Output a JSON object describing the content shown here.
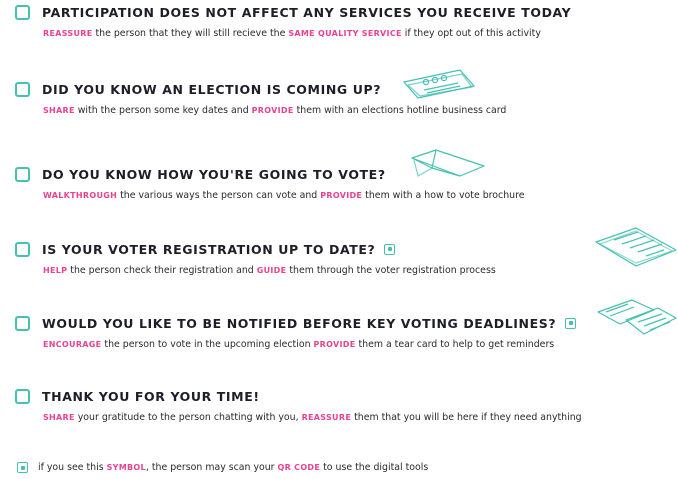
{
  "colors": {
    "accent": "#45c1b2",
    "highlight": "#e8438f",
    "text": "#1e1e28"
  },
  "items": [
    {
      "title": "PARTICIPATION DOES NOT AFFECT ANY SERVICES YOU RECEIVE TODAY",
      "desc": [
        {
          "hl": "REASSURE"
        },
        {
          "t": " the person that they will still recieve the "
        },
        {
          "hl": "SAME QUALITY SERVICE"
        },
        {
          "t": " if they opt out of this activity"
        }
      ]
    },
    {
      "title": "DID YOU KNOW AN ELECTION IS COMING UP?",
      "desc": [
        {
          "hl": "SHARE"
        },
        {
          "t": " with the person some key dates and "
        },
        {
          "hl": "PROVIDE"
        },
        {
          "t": " them with an elections hotline business card"
        }
      ]
    },
    {
      "title": "DO YOU KNOW HOW YOU'RE GOING TO VOTE?",
      "desc": [
        {
          "hl": "WALKTHROUGH"
        },
        {
          "t": " the various ways the person can vote and "
        },
        {
          "hl": "PROVIDE"
        },
        {
          "t": " them with a how to vote brochure"
        }
      ]
    },
    {
      "title": "IS YOUR VOTER REGISTRATION UP TO DATE?",
      "desc": [
        {
          "hl": "HELP"
        },
        {
          "t": " the person check their registration and "
        },
        {
          "hl": "GUIDE"
        },
        {
          "t": " them through the voter registration process"
        }
      ]
    },
    {
      "title": "WOULD YOU LIKE TO BE NOTIFIED BEFORE KEY VOTING DEADLINES?",
      "desc": [
        {
          "hl": "ENCOURAGE"
        },
        {
          "t": " the person to vote in the upcoming election "
        },
        {
          "hl": "PROVIDE"
        },
        {
          "t": " them a tear card to help to get reminders"
        }
      ]
    },
    {
      "title": "THANK YOU FOR YOUR TIME!",
      "desc": [
        {
          "hl": "SHARE"
        },
        {
          "t": " your gratitude to the person chatting with you, "
        },
        {
          "hl": "REASSURE"
        },
        {
          "t": " them that you will be here if they need anything"
        }
      ]
    }
  ],
  "footer": [
    {
      "t": "if you see this "
    },
    {
      "hl": "SYMBOL"
    },
    {
      "t": ", the person may scan your "
    },
    {
      "hl": "QR CODE"
    },
    {
      "t": " to use the digital tools"
    }
  ],
  "icons": {
    "qr_symbol": "qr-symbol-icon",
    "business_card": "business-card-icon",
    "brochure": "brochure-icon",
    "registration_form": "registration-form-icon",
    "tear_card": "tear-card-icon"
  }
}
